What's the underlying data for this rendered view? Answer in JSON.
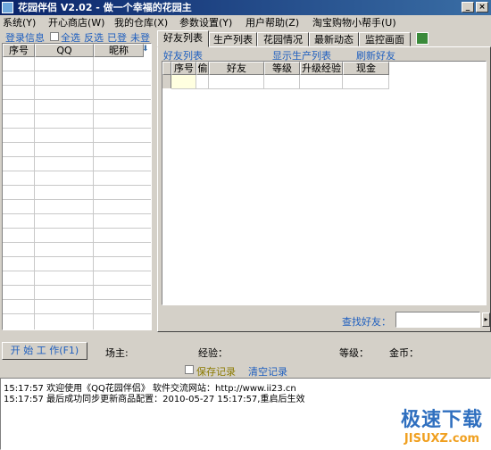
{
  "window": {
    "title": "花园伴侣 V2.02 - 做一个幸福的花园主"
  },
  "menu": [
    "系统(Y)",
    "开心商店(W)",
    "我的仓库(X)",
    "参数设置(Y)",
    "用户帮助(Z)",
    "淘宝购物小帮手(U)"
  ],
  "left": {
    "toolbar": {
      "login_info": "登录信息",
      "select_all": "全选",
      "invert": "反选",
      "logged_in": "已登",
      "not_logged_in": "未登"
    },
    "columns": [
      "序号",
      "QQ",
      "昵称"
    ]
  },
  "tabs": [
    "好友列表",
    "生产列表",
    "花园情况",
    "最新动态",
    "监控画面"
  ],
  "friends": {
    "label": "好友列表",
    "show_producing": "显示生产列表",
    "refresh": "刷新好友",
    "columns": [
      "序号",
      "偷",
      "好友",
      "等级",
      "升级经验",
      "现金"
    ],
    "search_label": "查找好友：",
    "search_value": ""
  },
  "status": {
    "start_button": "开 始 工 作(F1)",
    "owner_label": "场主:",
    "exp_label": "经验：",
    "level_label": "等级：",
    "gold_label": "金币："
  },
  "log": {
    "save_records": "保存记录",
    "clear_records": "清空记录",
    "lines": [
      "15:17:57 欢迎使用《QQ花园伴侣》 软件交流网站：http://www.ii23.cn",
      "15:17:57 最后成功同步更新商品配置：2010-05-27 15:17:57,重启后生效"
    ]
  },
  "watermark": {
    "text": "极速下载",
    "url": "JISUXZ.com"
  }
}
